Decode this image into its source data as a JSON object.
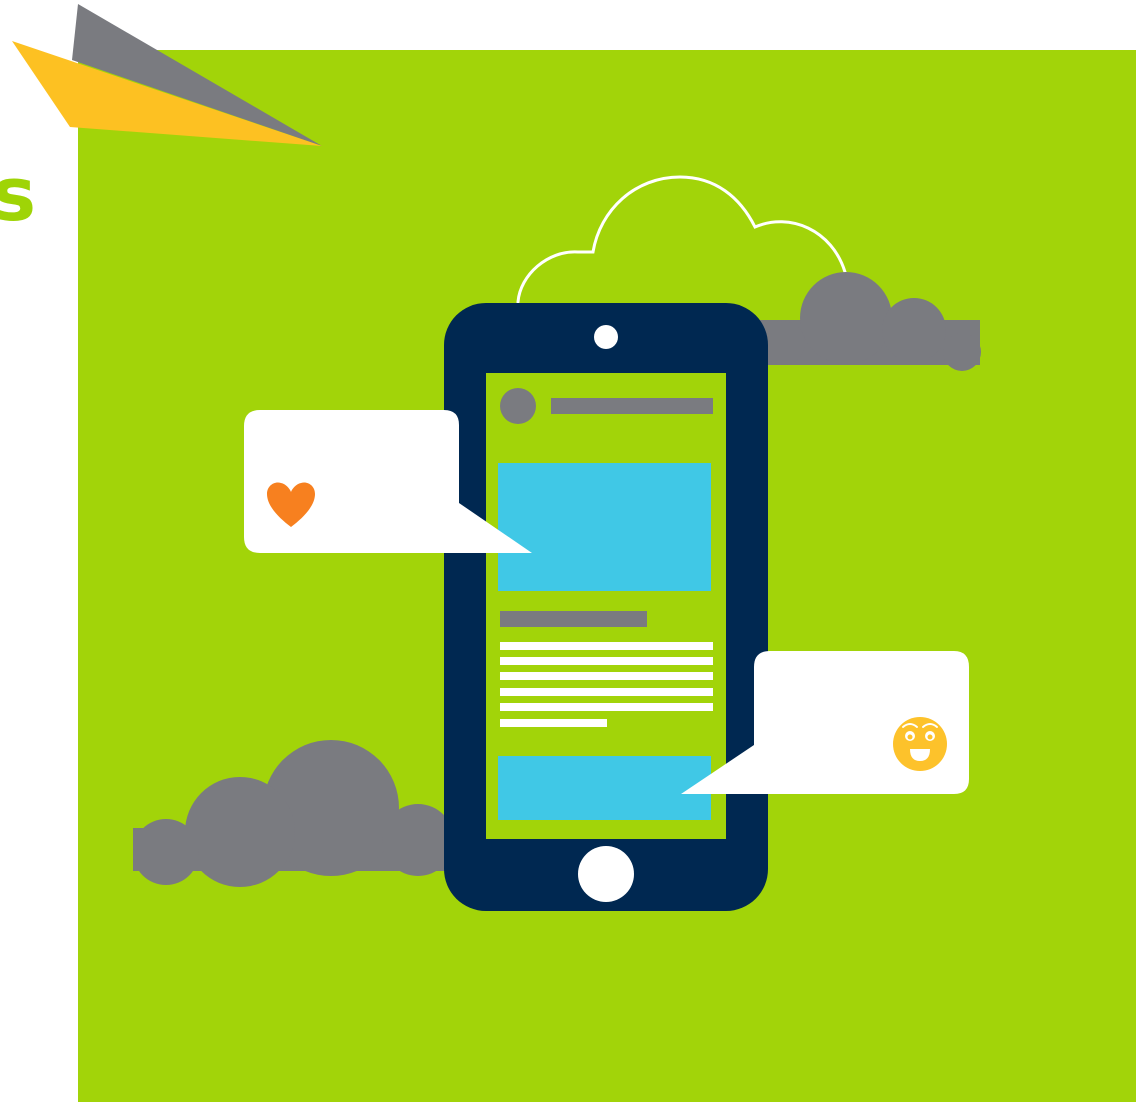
{
  "illustration": {
    "edge_glyph": "s",
    "colors": {
      "page_background": "#ffffff",
      "green_panel": "#a2d409",
      "phone_body": "#002851",
      "phone_screen": "#a2d409",
      "content_block": "#40c8e6",
      "placeholder_bar": "#7a7b80",
      "text_line": "#ffffff",
      "cloud_gray": "#7a7b80",
      "cloud_outline": "#ffffff",
      "bubble": "#ffffff",
      "heart": "#f7801f",
      "smiley": "#fdc22b",
      "plane_yellow": "#fdc122",
      "plane_gray": "#7a7b80",
      "glyph": "#9fd406"
    },
    "icons": {
      "heart": "heart-icon",
      "smiley": "smiley-icon",
      "paper_plane": "paper-plane-icon",
      "camera": "camera-icon",
      "home_button": "home-button-icon"
    }
  }
}
